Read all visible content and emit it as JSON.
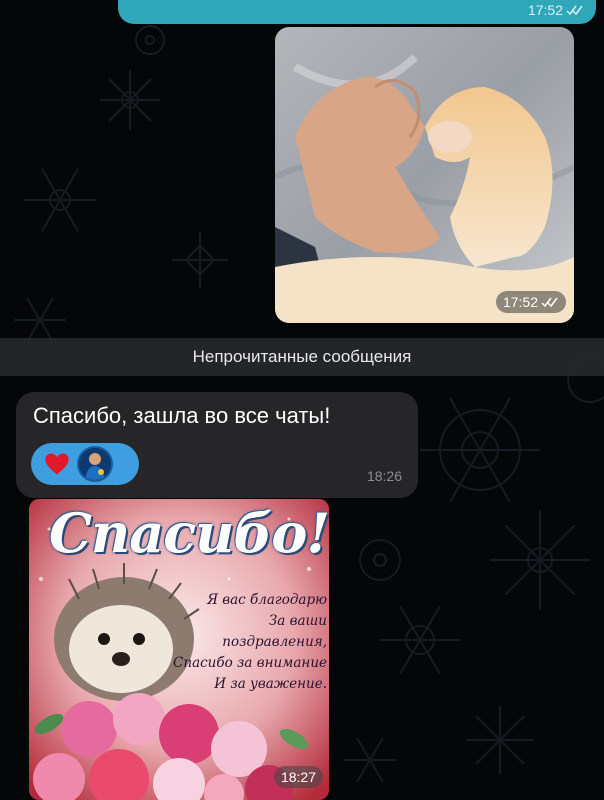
{
  "messages": {
    "top_outgoing": {
      "time": "17:52"
    },
    "cat_photo": {
      "time": "17:52"
    },
    "unread_divider": "Непрочитанные сообщения",
    "incoming_text": {
      "text": "Спасибо, зашла во все чаты!",
      "time": "18:26",
      "reactions": [
        "heart-emoji",
        "avatar-reaction"
      ]
    },
    "greeting_card": {
      "title": "Спасибо!",
      "lines": [
        "Я вас благодарю",
        "За ваши",
        "поздравления,",
        "Спасибо за внимание",
        "И за уважение."
      ],
      "time": "18:27"
    }
  },
  "colors": {
    "outgoing_bubble": "#2fa7b8",
    "incoming_bubble": "#262628",
    "reaction_pill": "#3f9ee0",
    "background": "#050607"
  }
}
